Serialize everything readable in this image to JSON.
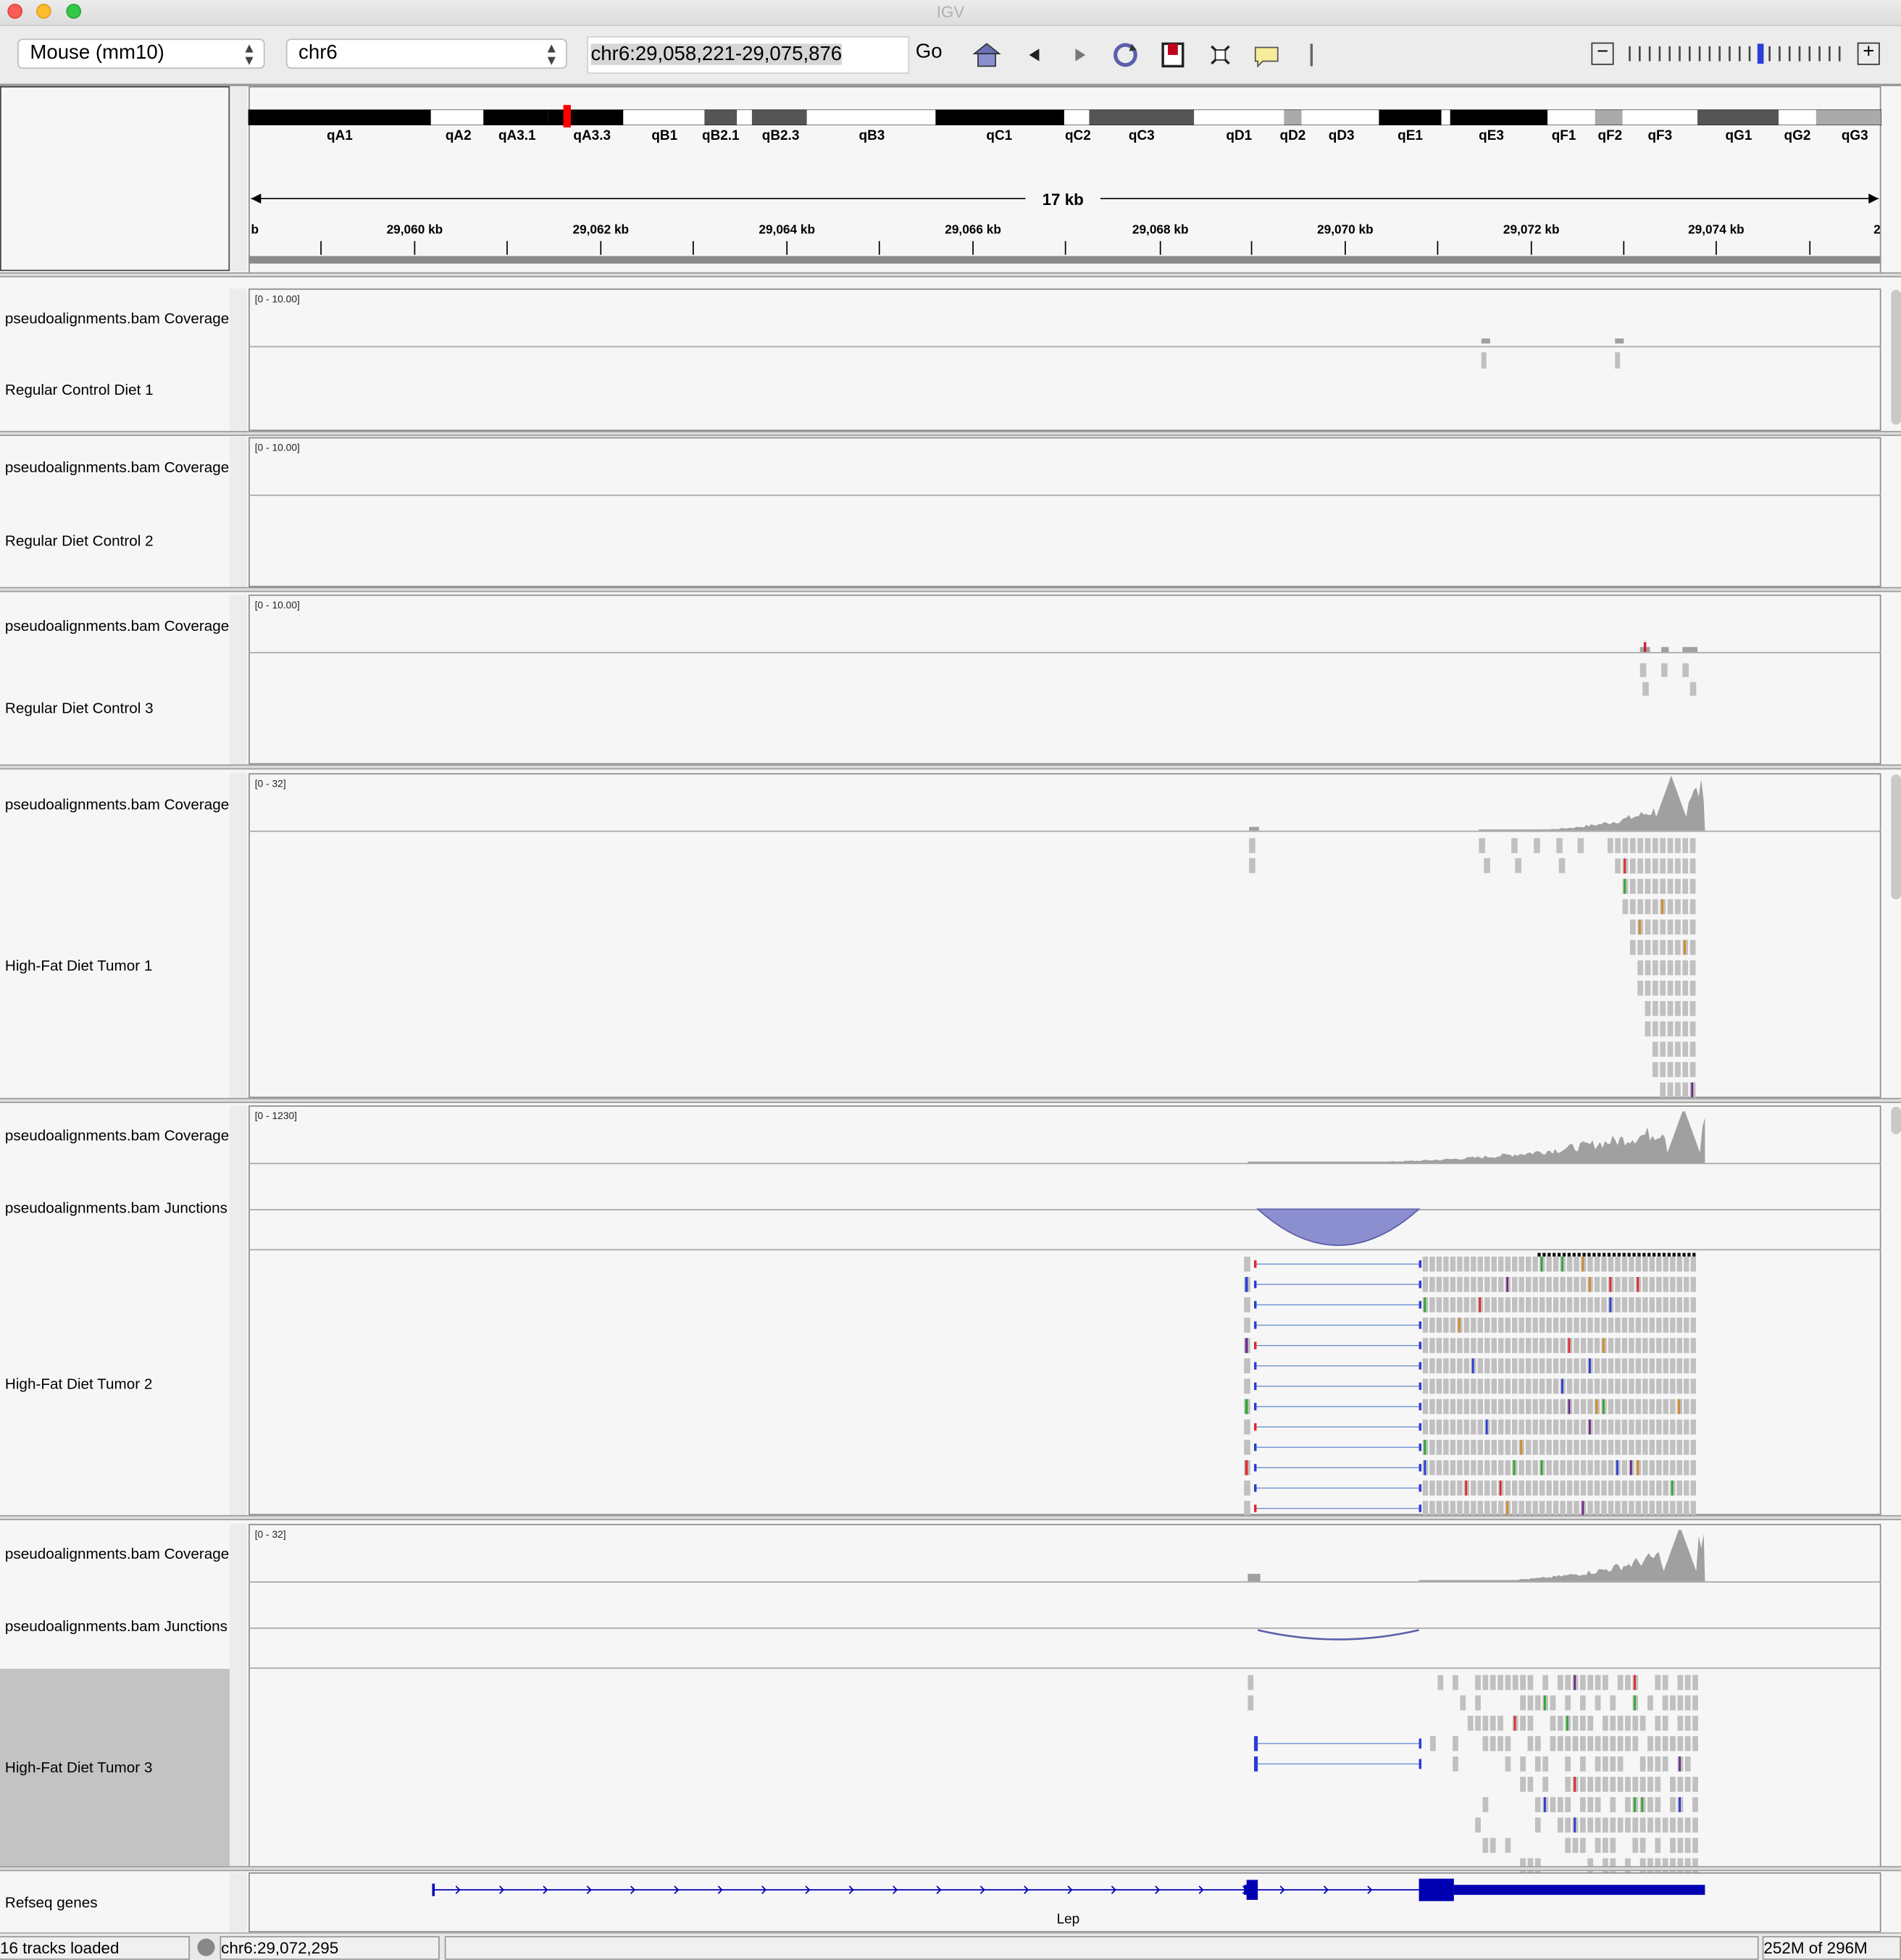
{
  "window": {
    "title": "IGV"
  },
  "toolbar": {
    "genome": "Mouse (mm10)",
    "chromosome": "chr6",
    "locus": "chr6:29,058,221-29,075,876",
    "go_label": "Go",
    "icons": [
      "home-icon",
      "back-icon",
      "forward-icon",
      "refresh-icon",
      "region-of-interest-icon",
      "resize-icon",
      "popup-info-icon"
    ]
  },
  "ideogram": {
    "bands": [
      "qA1",
      "qA2",
      "qA3.1",
      "qA3.3",
      "qB1",
      "qB2.1",
      "qB2.3",
      "qB3",
      "qC1",
      "qC2",
      "qC3",
      "qD1",
      "qD2",
      "qD3",
      "qE1",
      "qE3",
      "qF1",
      "qF2",
      "qF3",
      "qG1",
      "qG2",
      "qG3"
    ],
    "highlight_color": "#ff0000"
  },
  "ruler": {
    "span_label": "17 kb",
    "left_cut": "b",
    "right_cut": "2",
    "ticks": [
      "29,060 kb",
      "29,062 kb",
      "29,064 kb",
      "29,066 kb",
      "29,068 kb",
      "29,070 kb",
      "29,072 kb",
      "29,074 kb"
    ]
  },
  "samples": [
    {
      "name": "Regular Control Diet 1",
      "coverage_label": "pseudoalignments.bam Coverage",
      "range": "[0 - 10.00]"
    },
    {
      "name": "Regular Diet Control 2",
      "coverage_label": "pseudoalignments.bam Coverage",
      "range": "[0 - 10.00]"
    },
    {
      "name": "Regular Diet Control 3",
      "coverage_label": "pseudoalignments.bam Coverage",
      "range": "[0 - 10.00]"
    },
    {
      "name": "High-Fat Diet Tumor 1",
      "coverage_label": "pseudoalignments.bam Coverage",
      "range": "[0 - 32]"
    },
    {
      "name": "High-Fat Diet Tumor 2",
      "coverage_label": "pseudoalignments.bam Coverage",
      "junctions_label": "pseudoalignments.bam Junctions",
      "range": "[0 - 1230]"
    },
    {
      "name": "High-Fat Diet Tumor 3",
      "coverage_label": "pseudoalignments.bam Coverage",
      "junctions_label": "pseudoalignments.bam Junctions",
      "range": "[0 - 32]"
    }
  ],
  "refseq": {
    "track_name": "Refseq genes",
    "gene": "Lep",
    "color": "#0000b3"
  },
  "status": {
    "tracks_loaded": "16 tracks loaded",
    "position": "chr6:29,072,295",
    "memory": "252M of 296M"
  },
  "colors": {
    "read": "#c0c0c0",
    "coverage": "#a0a0a0",
    "junction": "#8c8fcf"
  }
}
